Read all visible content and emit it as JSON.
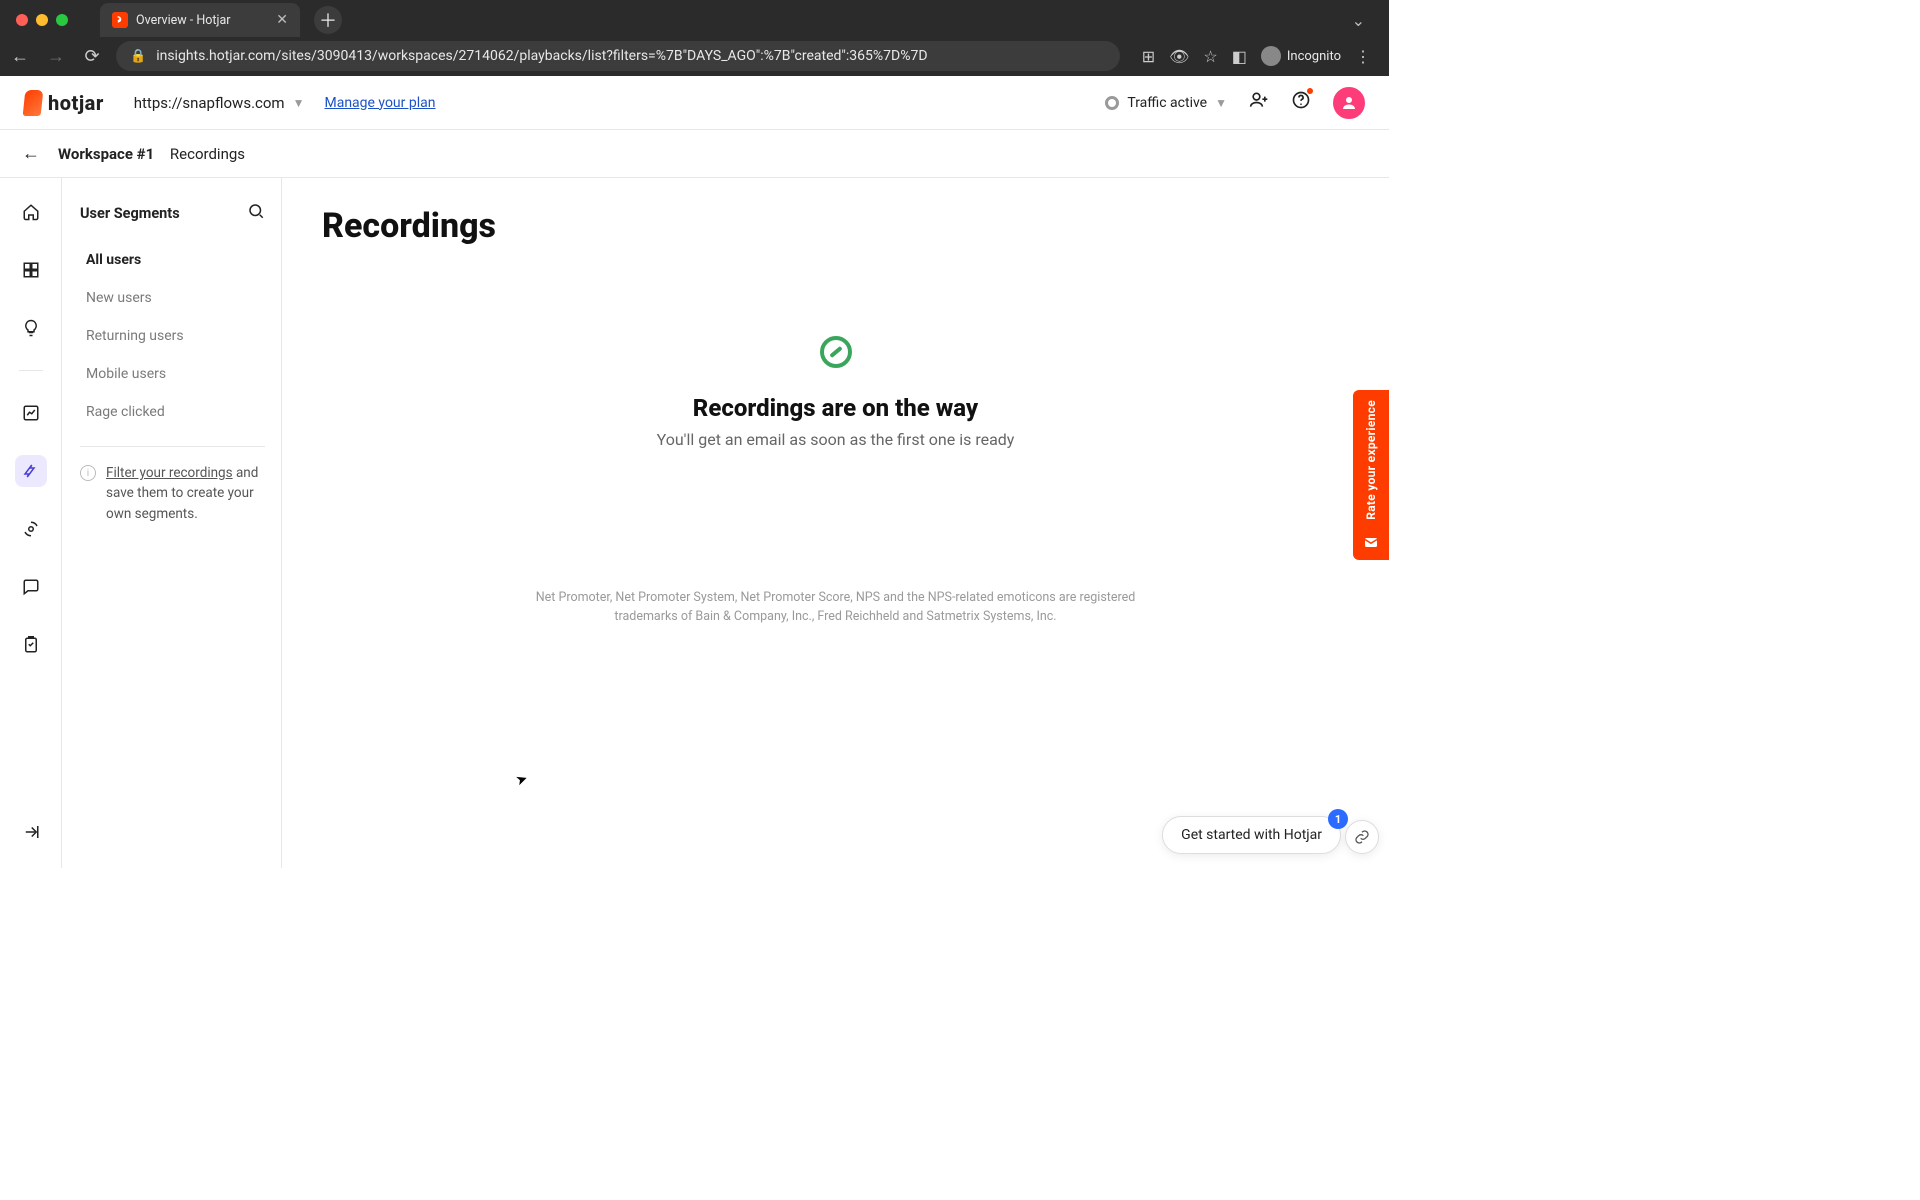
{
  "browser": {
    "tab_title": "Overview - Hotjar",
    "url": "insights.hotjar.com/sites/3090413/workspaces/2714062/playbacks/list?filters=%7B\"DAYS_AGO\":%7B\"created\":365%7D%7D",
    "incognito_label": "Incognito"
  },
  "header": {
    "logo_text": "hotjar",
    "site_selector": "https://snapflows.com",
    "manage_plan": "Manage your plan",
    "traffic_label": "Traffic active"
  },
  "breadcrumb": {
    "workspace": "Workspace #1",
    "page": "Recordings"
  },
  "segments": {
    "title": "User Segments",
    "items": [
      "All users",
      "New users",
      "Returning users",
      "Mobile users",
      "Rage clicked"
    ],
    "tip_link": "Filter your recordings",
    "tip_rest": " and save them to create your own segments."
  },
  "content": {
    "title": "Recordings",
    "empty_title": "Recordings are on the way",
    "empty_sub": "You'll get an email as soon as the first one is ready",
    "legal": "Net Promoter, Net Promoter System, Net Promoter Score, NPS and the NPS-related emoticons are registered trademarks of Bain & Company, Inc., Fred Reichheld and Satmetrix Systems, Inc."
  },
  "widgets": {
    "rate_label": "Rate your experience",
    "get_started": "Get started with Hotjar",
    "badge_count": "1"
  }
}
